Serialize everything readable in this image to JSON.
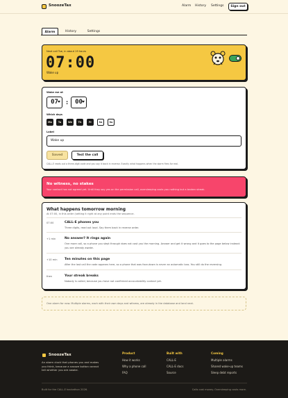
{
  "header": {
    "brand": "SnoozeTax",
    "nav": [
      "Alarm",
      "History",
      "Settings"
    ],
    "sign_out": "Sign out"
  },
  "tabs": [
    {
      "label": "Alarm",
      "active": true
    },
    {
      "label": "History",
      "active": false
    },
    {
      "label": "Settings",
      "active": false
    }
  ],
  "alarm_card": {
    "next_call": "Next call Tue, in about 19 hours",
    "time": "07:00",
    "label": "Wake up",
    "enabled": true,
    "bg_color": "#f5c842"
  },
  "form": {
    "wake_me_at": "Wake me at",
    "hour": "07",
    "separator": ":",
    "minute": "00",
    "which_days": "Which days",
    "days": [
      {
        "label": "Mo",
        "on": true
      },
      {
        "label": "Tu",
        "on": true
      },
      {
        "label": "We",
        "on": true
      },
      {
        "label": "Th",
        "on": true
      },
      {
        "label": "Fr",
        "on": true
      },
      {
        "label": "Sa",
        "on": false
      },
      {
        "label": "Su",
        "on": false
      }
    ],
    "label_heading": "Label",
    "label_value": "Wake up",
    "saved_label": "Saved",
    "test_label": "Test the call",
    "note": "CALL-E reads out a three-digit code and you say it back in reverse. Exactly what happens when the alarm fires for real."
  },
  "warning": {
    "title": "No witness, no stakes",
    "body": "Your contact has not agreed yet. Until they say yes on the permission call, oversleeping costs you nothing but a broken streak.",
    "bg_color": "#f7456b"
  },
  "timeline": {
    "title": "What happens tomorrow morning",
    "subtitle": "At 07:00, in this order (setting it right at any point ends the sequence.",
    "rows": [
      {
        "time": "07:00",
        "title": "CALL-E phones you",
        "desc": "Three digits, read out loud. Say them back in reverse order."
      },
      {
        "time": "+1 min",
        "title": "No answer? It rings again",
        "desc": "One more call, so a phone you slept through does not cost you the morning. Answer and get it wrong and it goes to the page below instead: you are already awake."
      },
      {
        "time": "+10 min",
        "title": "Ten minutes on this page",
        "desc": "After the last call the code appears here, so a phone that was face-down is never an automatic loss. You still do the reversing."
      },
      {
        "time": "then",
        "title": "Your streak breaks",
        "desc": "Nobody is called, because you have not confirmed accountability contact yet."
      }
    ]
  },
  "info_note": "One alarm for now. Multiple alarms, each with their own days and witness, are already in the database and land next.",
  "footer": {
    "brand": "SnoozeTax",
    "tagline": "An alarm clock that phones you and makes you think, because a snooze button cannot tell whether you are awake.",
    "columns": [
      {
        "heading": "Product",
        "links": [
          "How it works",
          "Why a phone call",
          "FAQ"
        ]
      },
      {
        "heading": "Built with",
        "links": [
          "CALL-E",
          "CALL-E docs",
          "Source"
        ]
      },
      {
        "heading": "Coming",
        "links": [
          "Multiple alarms",
          "Shared wake-up teams",
          "Sleep debt reports"
        ]
      }
    ],
    "bottom_left": "Built for the CALL-E hackathon 2026.",
    "bottom_right": "Calls cost money. Oversleeping costs more."
  }
}
